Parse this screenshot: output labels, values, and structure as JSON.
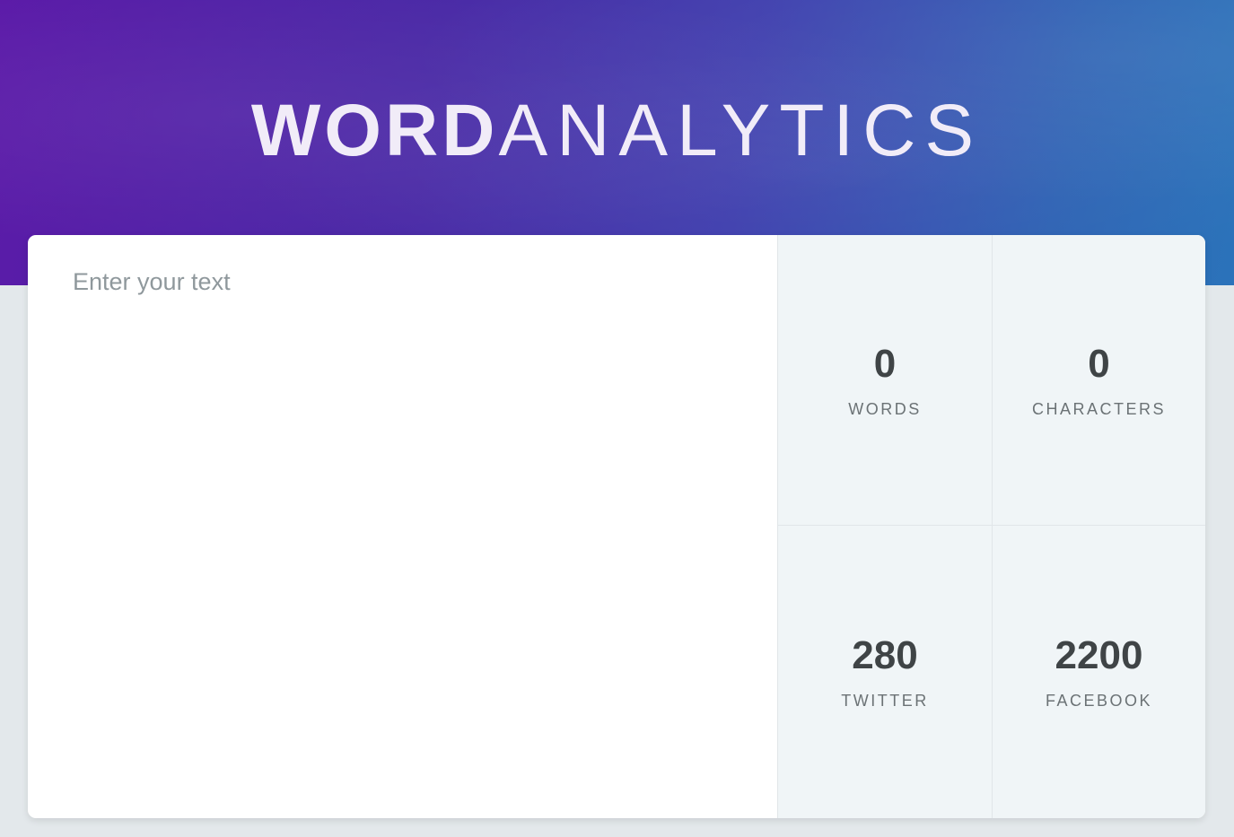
{
  "header": {
    "title_bold": "WORD",
    "title_light": "ANALYTICS",
    "gradient_start": "#5b1aa8",
    "gradient_end": "#2b73ba"
  },
  "editor": {
    "placeholder": "Enter your text",
    "value": ""
  },
  "stats": {
    "words": {
      "value": "0",
      "label": "WORDS"
    },
    "characters": {
      "value": "0",
      "label": "CHARACTERS"
    },
    "twitter": {
      "value": "280",
      "label": "TWITTER"
    },
    "facebook": {
      "value": "2200",
      "label": "FACEBOOK"
    }
  },
  "colors": {
    "page_background": "#e3e8eb",
    "stats_background": "#f0f5f7",
    "number_color": "#3f4446",
    "label_color": "#6b7275"
  }
}
